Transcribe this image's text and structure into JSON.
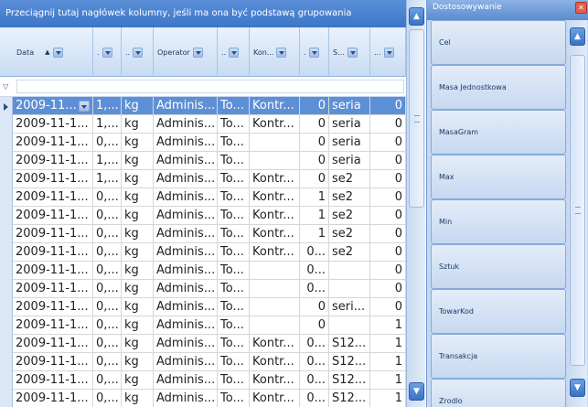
{
  "group_banner": "Przeciągnij tutaj nagłówek kolumny, jeśli ma ona być podstawą grupowania",
  "columns": [
    {
      "label": "Data",
      "sorted": true
    },
    {
      "label": "."
    },
    {
      "label": ".."
    },
    {
      "label": "Operator"
    },
    {
      "label": ".."
    },
    {
      "label": "Kon..."
    },
    {
      "label": "."
    },
    {
      "label": "S..."
    },
    {
      "label": "..."
    }
  ],
  "rows": [
    {
      "data": "2009-11...",
      "c1": "1,...",
      "c2": "kg",
      "operator": "Adminis...",
      "c4": "To...",
      "kontr": "Kontr...",
      "c6": "0",
      "s": "seria",
      "last": "0"
    },
    {
      "data": "2009-11-1...",
      "c1": "1,...",
      "c2": "kg",
      "operator": "Adminis...",
      "c4": "To...",
      "kontr": "Kontr...",
      "c6": "0",
      "s": "seria",
      "last": "0"
    },
    {
      "data": "2009-11-1...",
      "c1": "0,...",
      "c2": "kg",
      "operator": "Adminis...",
      "c4": "To...",
      "kontr": "",
      "c6": "0",
      "s": "seria",
      "last": "0"
    },
    {
      "data": "2009-11-1...",
      "c1": "1,...",
      "c2": "kg",
      "operator": "Adminis...",
      "c4": "To...",
      "kontr": "",
      "c6": "0",
      "s": "seria",
      "last": "0"
    },
    {
      "data": "2009-11-1...",
      "c1": "1,...",
      "c2": "kg",
      "operator": "Adminis...",
      "c4": "To...",
      "kontr": "Kontr...",
      "c6": "0",
      "s": "se2",
      "last": "0"
    },
    {
      "data": "2009-11-1...",
      "c1": "0,...",
      "c2": "kg",
      "operator": "Adminis...",
      "c4": "To...",
      "kontr": "Kontr...",
      "c6": "1",
      "s": "se2",
      "last": "0"
    },
    {
      "data": "2009-11-1...",
      "c1": "0,...",
      "c2": "kg",
      "operator": "Adminis...",
      "c4": "To...",
      "kontr": "Kontr...",
      "c6": "1",
      "s": "se2",
      "last": "0"
    },
    {
      "data": "2009-11-1...",
      "c1": "0,...",
      "c2": "kg",
      "operator": "Adminis...",
      "c4": "To...",
      "kontr": "Kontr...",
      "c6": "1",
      "s": "se2",
      "last": "0"
    },
    {
      "data": "2009-11-1...",
      "c1": "0,...",
      "c2": "kg",
      "operator": "Adminis...",
      "c4": "To...",
      "kontr": "Kontr...",
      "c6": "0...",
      "s": "se2",
      "last": "0"
    },
    {
      "data": "2009-11-1...",
      "c1": "0,...",
      "c2": "kg",
      "operator": "Adminis...",
      "c4": "To...",
      "kontr": "",
      "c6": "0...",
      "s": "",
      "last": "0"
    },
    {
      "data": "2009-11-1...",
      "c1": "0,...",
      "c2": "kg",
      "operator": "Adminis...",
      "c4": "To...",
      "kontr": "",
      "c6": "0...",
      "s": "",
      "last": "0"
    },
    {
      "data": "2009-11-1...",
      "c1": "0,...",
      "c2": "kg",
      "operator": "Adminis...",
      "c4": "To...",
      "kontr": "",
      "c6": "0",
      "s": "seri...",
      "last": "0"
    },
    {
      "data": "2009-11-1...",
      "c1": "0,...",
      "c2": "kg",
      "operator": "Adminis...",
      "c4": "To...",
      "kontr": "",
      "c6": "0",
      "s": "",
      "last": "1"
    },
    {
      "data": "2009-11-1...",
      "c1": "0,...",
      "c2": "kg",
      "operator": "Adminis...",
      "c4": "To...",
      "kontr": "Kontr...",
      "c6": "0...",
      "s": "S12...",
      "last": "1"
    },
    {
      "data": "2009-11-1...",
      "c1": "0,...",
      "c2": "kg",
      "operator": "Adminis...",
      "c4": "To...",
      "kontr": "Kontr...",
      "c6": "0...",
      "s": "S12...",
      "last": "1"
    },
    {
      "data": "2009-11-1...",
      "c1": "0,...",
      "c2": "kg",
      "operator": "Adminis...",
      "c4": "To...",
      "kontr": "Kontr...",
      "c6": "0...",
      "s": "S12...",
      "last": "1"
    },
    {
      "data": "2009-11-1...",
      "c1": "0,...",
      "c2": "kg",
      "operator": "Adminis...",
      "c4": "To...",
      "kontr": "Kontr...",
      "c6": "0...",
      "s": "S12...",
      "last": "1"
    }
  ],
  "panel": {
    "title": "Dostosowywanie",
    "items": [
      "Cel",
      "Masa Jednostkowa",
      "MasaGram",
      "Max",
      "Min",
      "Sztuk",
      "TowarKod",
      "Transakcja",
      "Zrodlo"
    ]
  },
  "icons": {
    "scroll_up": "chevron-up-icon",
    "scroll_down": "chevron-down-icon",
    "close": "close-icon",
    "filter": "filter-icon",
    "row_indicator": "row-indicator-icon"
  },
  "colors": {
    "banner": "#3d76c9",
    "selected_row": "#5d8fd6",
    "panel_bg": "#c6d8f1"
  }
}
